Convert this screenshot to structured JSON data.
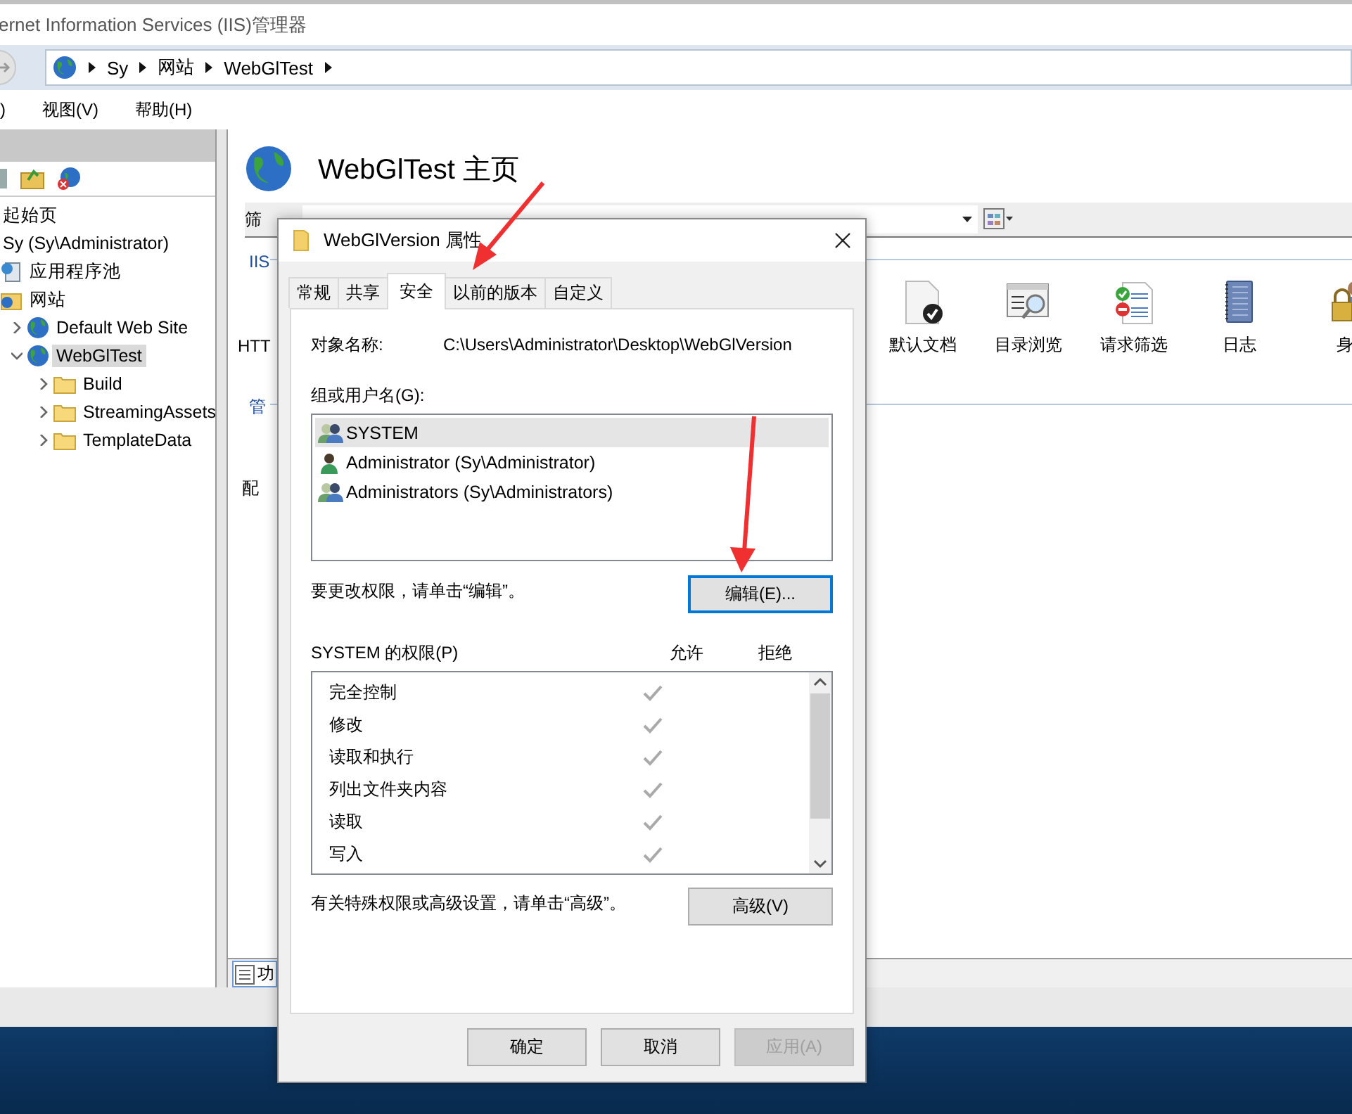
{
  "window": {
    "title": "ernet Information Services (IIS)管理器"
  },
  "breadcrumb": [
    "Sy",
    "网站",
    "WebGlTest"
  ],
  "menu": [
    ")",
    "视图(V)",
    "帮助(H)"
  ],
  "tree": [
    {
      "label": "起始页",
      "selected": false
    },
    {
      "label": "Sy (Sy\\Administrator)",
      "selected": false,
      "children": [
        {
          "label": "应用程序池",
          "kind": "pool",
          "selected": false
        },
        {
          "label": "网站",
          "kind": "sites",
          "selected": false,
          "children": [
            {
              "label": "Default Web Site",
              "kind": "site",
              "selected": false,
              "expanded": false
            },
            {
              "label": "WebGlTest",
              "kind": "site",
              "selected": true,
              "expanded": true,
              "children": [
                {
                  "label": "Build",
                  "kind": "folder",
                  "selected": false,
                  "expanded": false
                },
                {
                  "label": "StreamingAssets",
                  "kind": "folder",
                  "selected": false,
                  "expanded": false
                },
                {
                  "label": "TemplateData",
                  "kind": "folder",
                  "selected": false,
                  "expanded": false
                }
              ]
            }
          ]
        }
      ]
    }
  ],
  "home": {
    "title": "WebGlTest 主页",
    "filter_label": "筛",
    "side_labels": [
      {
        "text": "IIS",
        "kind": "group"
      },
      {
        "text": "HTT",
        "kind": "plain"
      },
      {
        "text": "管",
        "kind": "group"
      },
      {
        "text": "配",
        "kind": "plain"
      }
    ],
    "features": [
      {
        "label": "默认文档",
        "kind": "document"
      },
      {
        "label": "目录浏览",
        "kind": "browse"
      },
      {
        "label": "请求筛选",
        "kind": "filter"
      },
      {
        "label": "日志",
        "kind": "log"
      },
      {
        "label": "身",
        "kind": "auth"
      }
    ],
    "bottom_tab": "功"
  },
  "dialog": {
    "title": "WebGlVersion 属性",
    "tabs": [
      {
        "label": "常规",
        "selected": false
      },
      {
        "label": "共享",
        "selected": false
      },
      {
        "label": "安全",
        "selected": true
      },
      {
        "label": "以前的版本",
        "selected": false
      },
      {
        "label": "自定义",
        "selected": false
      }
    ],
    "object_label": "对象名称:",
    "object_value": "C:\\Users\\Administrator\\Desktop\\WebGlVersion",
    "principals_label": "组或用户名(G):",
    "principals": [
      {
        "name": "SYSTEM",
        "kind": "group",
        "selected": true
      },
      {
        "name": "Administrator (Sy\\Administrator)",
        "kind": "user",
        "selected": false
      },
      {
        "name": "Administrators (Sy\\Administrators)",
        "kind": "group",
        "selected": false
      }
    ],
    "edit_hint": "要更改权限，请单击“编辑”。",
    "edit_button": "编辑(E)...",
    "permissions_label": "SYSTEM 的权限(P)",
    "allow_label": "允许",
    "deny_label": "拒绝",
    "permissions": [
      {
        "name": "完全控制",
        "allow": true,
        "deny": false
      },
      {
        "name": "修改",
        "allow": true,
        "deny": false
      },
      {
        "name": "读取和执行",
        "allow": true,
        "deny": false
      },
      {
        "name": "列出文件夹内容",
        "allow": true,
        "deny": false
      },
      {
        "name": "读取",
        "allow": true,
        "deny": false
      },
      {
        "name": "写入",
        "allow": true,
        "deny": false
      }
    ],
    "advanced_hint": "有关特殊权限或高级设置，请单击“高级”。",
    "advanced_button": "高级(V)",
    "buttons": [
      {
        "label": "确定",
        "disabled": false
      },
      {
        "label": "取消",
        "disabled": false
      },
      {
        "label": "应用(A)",
        "disabled": true
      }
    ]
  }
}
